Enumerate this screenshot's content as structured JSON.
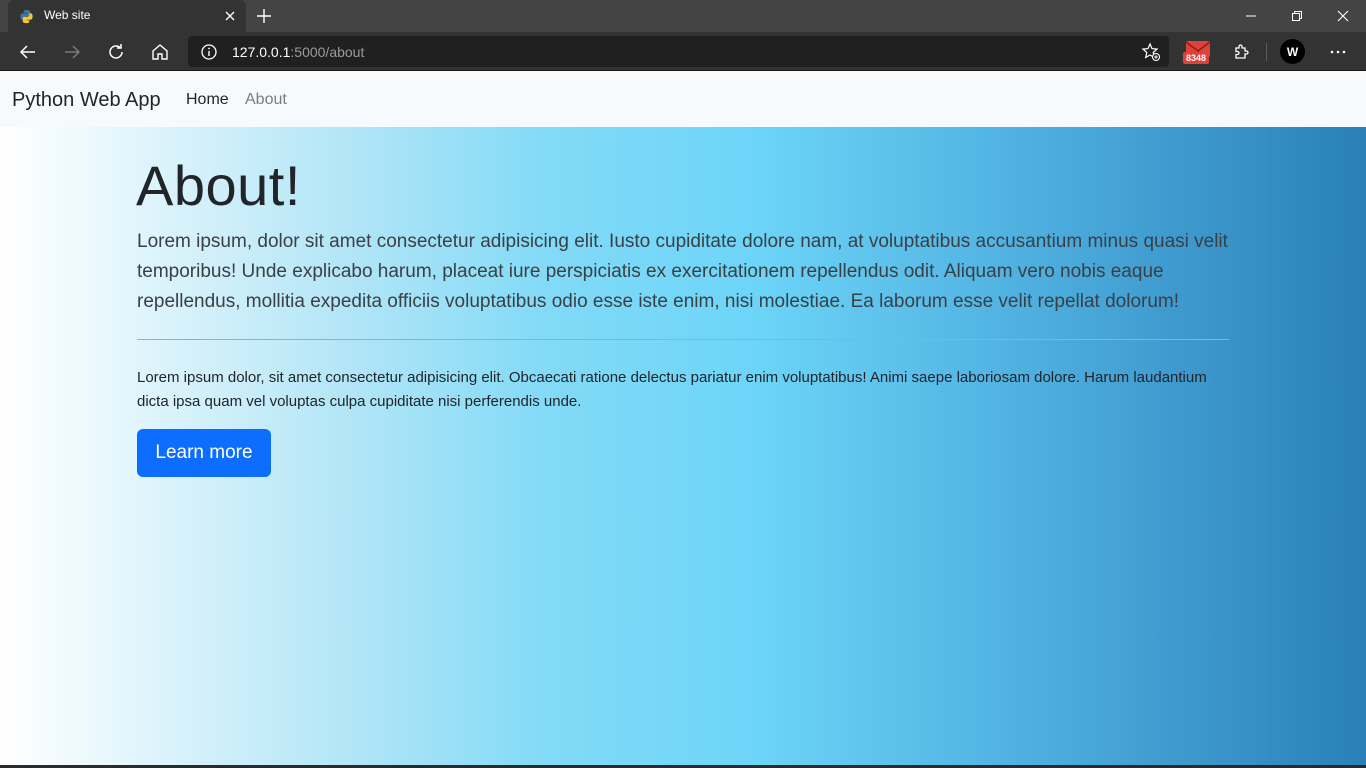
{
  "browser": {
    "tab": {
      "title": "Web site",
      "favicon": "python-icon"
    },
    "url": {
      "host": "127.0.0.1",
      "path": ":5000/about"
    },
    "extensions": {
      "mail_badge": "8348",
      "profile_initial": "W"
    },
    "icons": [
      "back-icon",
      "forward-icon",
      "refresh-icon",
      "home-icon",
      "info-icon",
      "favorites-add-icon",
      "mail-icon",
      "extensions-icon",
      "more-icon",
      "minimize-icon",
      "restore-icon",
      "close-icon"
    ]
  },
  "navbar": {
    "brand": "Python Web App",
    "links": [
      {
        "label": "Home",
        "active": true
      },
      {
        "label": "About",
        "active": false
      }
    ]
  },
  "hero": {
    "title": "About!",
    "lead": "Lorem ipsum, dolor sit amet consectetur adipisicing elit. Iusto cupiditate dolore nam, at voluptatibus accusantium minus quasi velit temporibus! Unde explicabo harum, placeat iure perspiciatis ex exercitationem repellendus odit. Aliquam vero nobis eaque repellendus, mollitia expedita officiis voluptatibus odio esse iste enim, nisi molestiae. Ea laborum esse velit repellat dolorum!",
    "body": "Lorem ipsum dolor, sit amet consectetur adipisicing elit. Obcaecati ratione delectus pariatur enim voluptatibus! Animi saepe laboriosam dolore. Harum laudantium dicta ipsa quam vel voluptas culpa cupiditate nisi perferendis unde.",
    "button_label": "Learn more"
  },
  "colors": {
    "button": "#0d6efd",
    "navbar_bg": "#f8f9fa",
    "gradient": [
      "#ffffff",
      "#6dd5f8",
      "#2a7fb8"
    ],
    "badge": "#e0413a"
  }
}
